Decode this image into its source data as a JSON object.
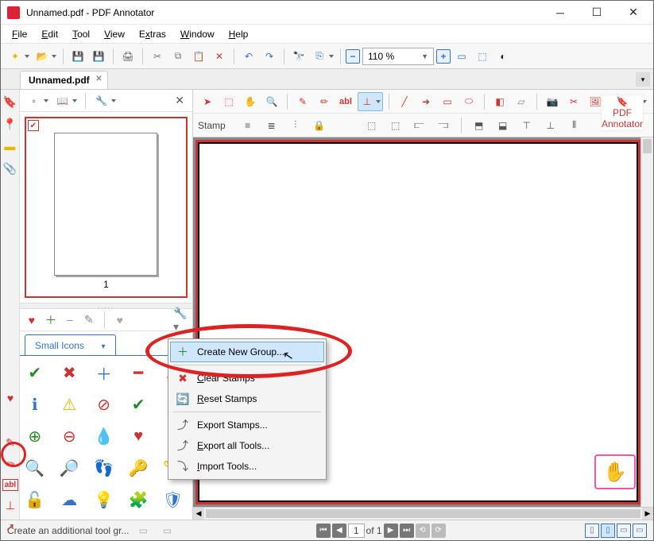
{
  "window": {
    "title": "Unnamed.pdf - PDF Annotator"
  },
  "menubar": {
    "file": "File",
    "edit": "Edit",
    "tool": "Tool",
    "view": "View",
    "extras": "Extras",
    "window": "Window",
    "help": "Help"
  },
  "toolbar1": {
    "zoom_value": "110 %"
  },
  "tab": {
    "label": "Unnamed.pdf"
  },
  "thumb": {
    "page_number": "1"
  },
  "panel_splitter": {
    "dots": "....."
  },
  "stamps_panel": {
    "tab_label": "Small Icons"
  },
  "doc_toolbar2": {
    "label": "Stamp"
  },
  "watermark": {
    "text": "PDF Annotator"
  },
  "context_menu": {
    "create_group": "Create New Group...",
    "clear": "Clear Stamps",
    "reset": "Reset Stamps",
    "export": "Export Stamps...",
    "export_all": "Export all Tools...",
    "import": "Import Tools..."
  },
  "statusbar": {
    "message": "Create an additional tool gr...",
    "page_current": "1",
    "page_total": "of 1"
  },
  "icons": {
    "heart": "♥",
    "plus": "＋",
    "minus": "−",
    "pencil": "✎",
    "gear": "⚙",
    "close": "✕",
    "check": "✔",
    "info": "ℹ",
    "warn": "⚠",
    "ban": "⊘",
    "search": "🔍",
    "lock": "🔓",
    "key": "🔑",
    "puzzle": "🧩",
    "shield": "🛡",
    "feet": "👣",
    "pin": "📍",
    "circle_plus": "⊕",
    "circle_minus": "⊖",
    "droplet": "💧",
    "zoomin": "🔎",
    "save": "💾",
    "print": "🖨",
    "cut": "✂",
    "copy": "📄",
    "paste": "📋",
    "undo": "↶",
    "redo": "↷",
    "find": "🔍",
    "binoc": "🔭",
    "book": "📖",
    "wrench": "🔧",
    "attach": "📎",
    "note": "📝",
    "page": "▭",
    "text": "abl",
    "stamp": "⊥",
    "arrow": "➜",
    "line": "╱",
    "circle": "◯",
    "ellipse": "⬭",
    "eraser": "◧",
    "camera": "📷",
    "crop": "✂",
    "img": "🖼",
    "pan": "✋"
  }
}
